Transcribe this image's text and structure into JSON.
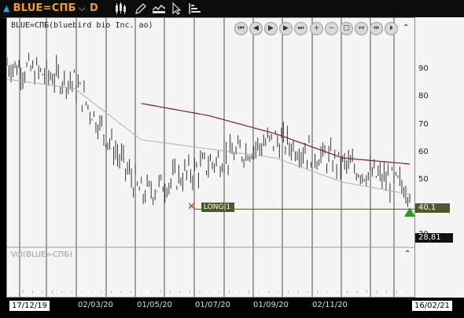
{
  "toolbar": {
    "symbol": "BLUE=СПБ",
    "period": "D",
    "icons": [
      "candlestick-icon",
      "draw-pen-icon",
      "indicator-icon",
      "cursor-icon",
      "settings-bars-icon"
    ]
  },
  "chart": {
    "symbol_label": "BLUE=СПБ(bluebird bio Inc. ao)",
    "volume_label": "Vol(BLUE=СПБ)",
    "nav_buttons": [
      "rewind-icon",
      "prev-icon",
      "play-icon",
      "forward-icon",
      "fast-forward-icon",
      "zoom-in-icon",
      "zoom-out-icon",
      "fit-icon",
      "expand-icon",
      "compress-icon",
      "end-icon"
    ],
    "colors": {
      "ma_long": "#8b1a1a",
      "ma_short": "#b0b0b0",
      "price": "#333333",
      "position": "#4a5a2a",
      "stop_x": "#e02020",
      "buy_arrow": "#2e9a1e"
    }
  },
  "yaxis": {
    "ticks": [
      "90",
      "80",
      "70",
      "60",
      "50",
      "40",
      "30"
    ]
  },
  "price_tags": {
    "last": "40,1",
    "low": "28,81"
  },
  "xaxis": {
    "start_date": "17/12/19",
    "end_date": "16/02/21",
    "ticks": [
      "02/03/20",
      "01/05/20",
      "01/07/20",
      "01/09/20",
      "02/11/20"
    ]
  },
  "trade": {
    "label": "LONG|1"
  },
  "chart_data": {
    "type": "line",
    "title": "BLUE=СПБ(bluebird bio Inc. ao)",
    "x": [
      "17/12/19",
      "02/03/20",
      "01/05/20",
      "01/07/20",
      "01/09/20",
      "02/11/20",
      "16/02/21"
    ],
    "series": [
      {
        "values": [
          88,
          82,
          45,
          55,
          63,
          55,
          47
        ],
        "color": "#333333"
      },
      {
        "values": [
          83,
          80,
          63,
          60,
          57,
          49,
          45
        ],
        "color": "#b0b0b0"
      },
      {
        "values": [
          null,
          null,
          75,
          71,
          65,
          57,
          55
        ],
        "color": "#8b1a1a"
      }
    ],
    "ylim": [
      28,
      98
    ],
    "last_value": 40.1,
    "marker_low": 28.81,
    "grid": true
  }
}
